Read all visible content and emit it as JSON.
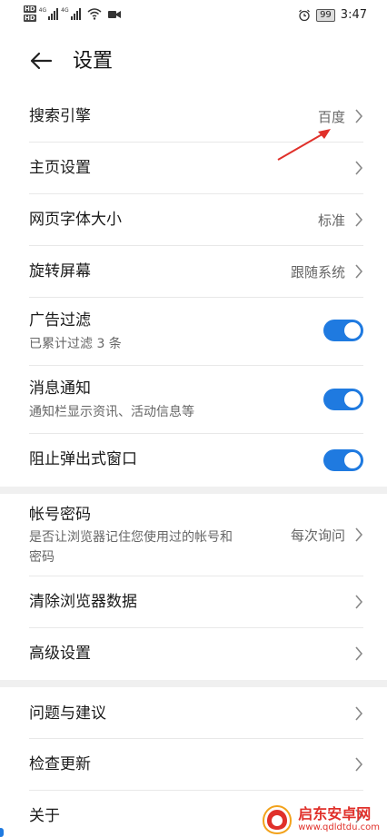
{
  "status_bar": {
    "hd_top": "HD",
    "hd_bottom": "HD",
    "sig1_tag": "4G",
    "sig2_tag": "4G",
    "battery": "99",
    "time": "3:47"
  },
  "header": {
    "title": "设置"
  },
  "settings": {
    "search_engine": {
      "label": "搜索引擎",
      "value": "百度"
    },
    "homepage": {
      "label": "主页设置"
    },
    "font_size": {
      "label": "网页字体大小",
      "value": "标准"
    },
    "rotate": {
      "label": "旋转屏幕",
      "value": "跟随系统"
    },
    "ad_filter": {
      "label": "广告过滤",
      "sub": "已累计过滤 3 条",
      "enabled": true
    },
    "notifications": {
      "label": "消息通知",
      "sub": "通知栏显示资讯、活动信息等",
      "enabled": true
    },
    "block_popups": {
      "label": "阻止弹出式窗口",
      "enabled": true
    },
    "account_password": {
      "label": "帐号密码",
      "sub_line1": "是否让浏览器记住您使用过的帐号和",
      "sub_line2": "密码",
      "value": "每次询问"
    },
    "clear_data": {
      "label": "清除浏览器数据"
    },
    "advanced": {
      "label": "高级设置"
    },
    "feedback": {
      "label": "问题与建议"
    },
    "check_update": {
      "label": "检查更新"
    },
    "about": {
      "label": "关于"
    }
  },
  "watermark": {
    "name": "启东安卓网",
    "url": "www.qdldtdu.com"
  },
  "colors": {
    "accent": "#1f7ae0",
    "annotation": "#e0302a"
  }
}
